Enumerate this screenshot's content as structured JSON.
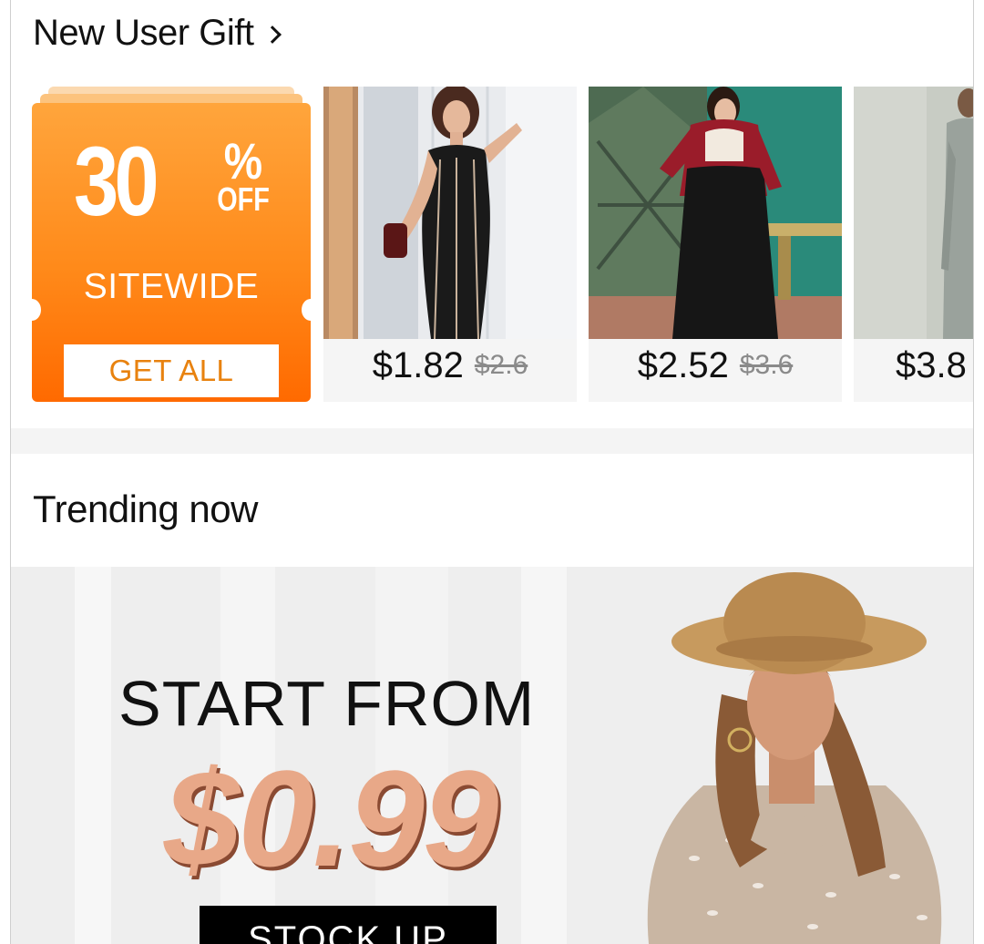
{
  "new_user_gift": {
    "title": "New User Gift",
    "coupon": {
      "percent": "30",
      "percent_sign": "%",
      "off": "OFF",
      "scope": "SITEWIDE",
      "button": "GET ALL"
    },
    "products": [
      {
        "price": "$1.82",
        "old_price": "$2.6"
      },
      {
        "price": "$2.52",
        "old_price": "$3.6"
      },
      {
        "price": "$3.8",
        "old_price": ""
      }
    ]
  },
  "trending": {
    "title": "Trending now",
    "banner": {
      "headline": "START FROM",
      "price": "$0.99",
      "button": "STOCK UP"
    }
  },
  "colors": {
    "coupon_orange": "#ff8a1a",
    "price_accent": "#e8a888",
    "button_black": "#000000"
  }
}
